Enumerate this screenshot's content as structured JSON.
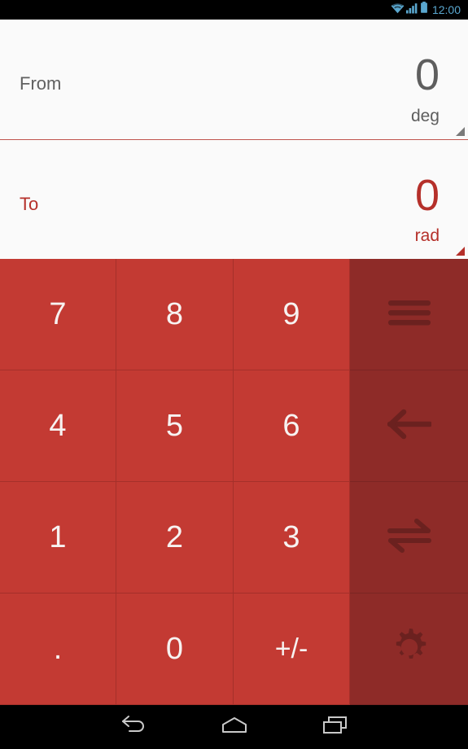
{
  "statusbar": {
    "clock": "12:00",
    "icons": [
      "wifi-icon",
      "signal-icon",
      "battery-icon"
    ],
    "accent_color": "#5aa7cf",
    "background": "#000000"
  },
  "converter": {
    "from": {
      "label": "From",
      "value": "0",
      "unit": "deg",
      "caret": "dropdown-caret",
      "text_color": "#5e5e5e"
    },
    "to": {
      "label": "To",
      "value": "0",
      "unit": "rad",
      "caret": "dropdown-caret",
      "text_color": "#b5302a"
    },
    "background": "#fafafa",
    "divider_color": "#c0544e"
  },
  "keypad": {
    "number_key_color": "#c33a33",
    "function_key_color": "#8e2b28",
    "key_text_color": "#f7f2f1",
    "rows": [
      {
        "keys": [
          "7",
          "8",
          "9"
        ],
        "fn": "menu-icon"
      },
      {
        "keys": [
          "4",
          "5",
          "6"
        ],
        "fn": "backspace-arrow-icon"
      },
      {
        "keys": [
          "1",
          "2",
          "3"
        ],
        "fn": "swap-icon"
      },
      {
        "keys": [
          ".",
          "0",
          "+/-"
        ],
        "fn": "settings-gear-icon"
      }
    ],
    "key_7": "7",
    "key_8": "8",
    "key_9": "9",
    "key_4": "4",
    "key_5": "5",
    "key_6": "6",
    "key_1": "1",
    "key_2": "2",
    "key_3": "3",
    "key_dot": ".",
    "key_0": "0",
    "key_plusminus": "+/-",
    "fn_menu": "menu-icon",
    "fn_backspace": "backspace-arrow-icon",
    "fn_swap": "swap-icon",
    "fn_settings": "settings-gear-icon"
  },
  "navbar": {
    "background": "#000000",
    "buttons": [
      "back-icon",
      "home-icon",
      "recents-icon"
    ]
  }
}
